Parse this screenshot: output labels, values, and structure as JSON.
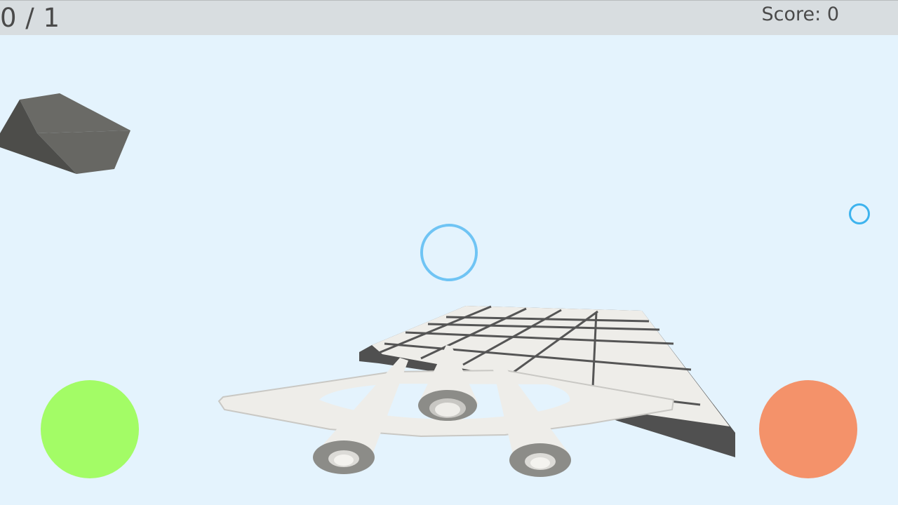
{
  "hud": {
    "progress": "0 / 1",
    "score": "Score: 0"
  },
  "controls": {
    "left_button_color": "#a3fc66",
    "right_button_color": "#f4926a"
  },
  "colors": {
    "sky": "#e4f3fd",
    "hud_bar": "#d8dde0",
    "hud_text": "#4a4a4a",
    "ring": "#6fc4f4",
    "ship": "#eeede9",
    "obstacle": "#5f5f5b"
  }
}
